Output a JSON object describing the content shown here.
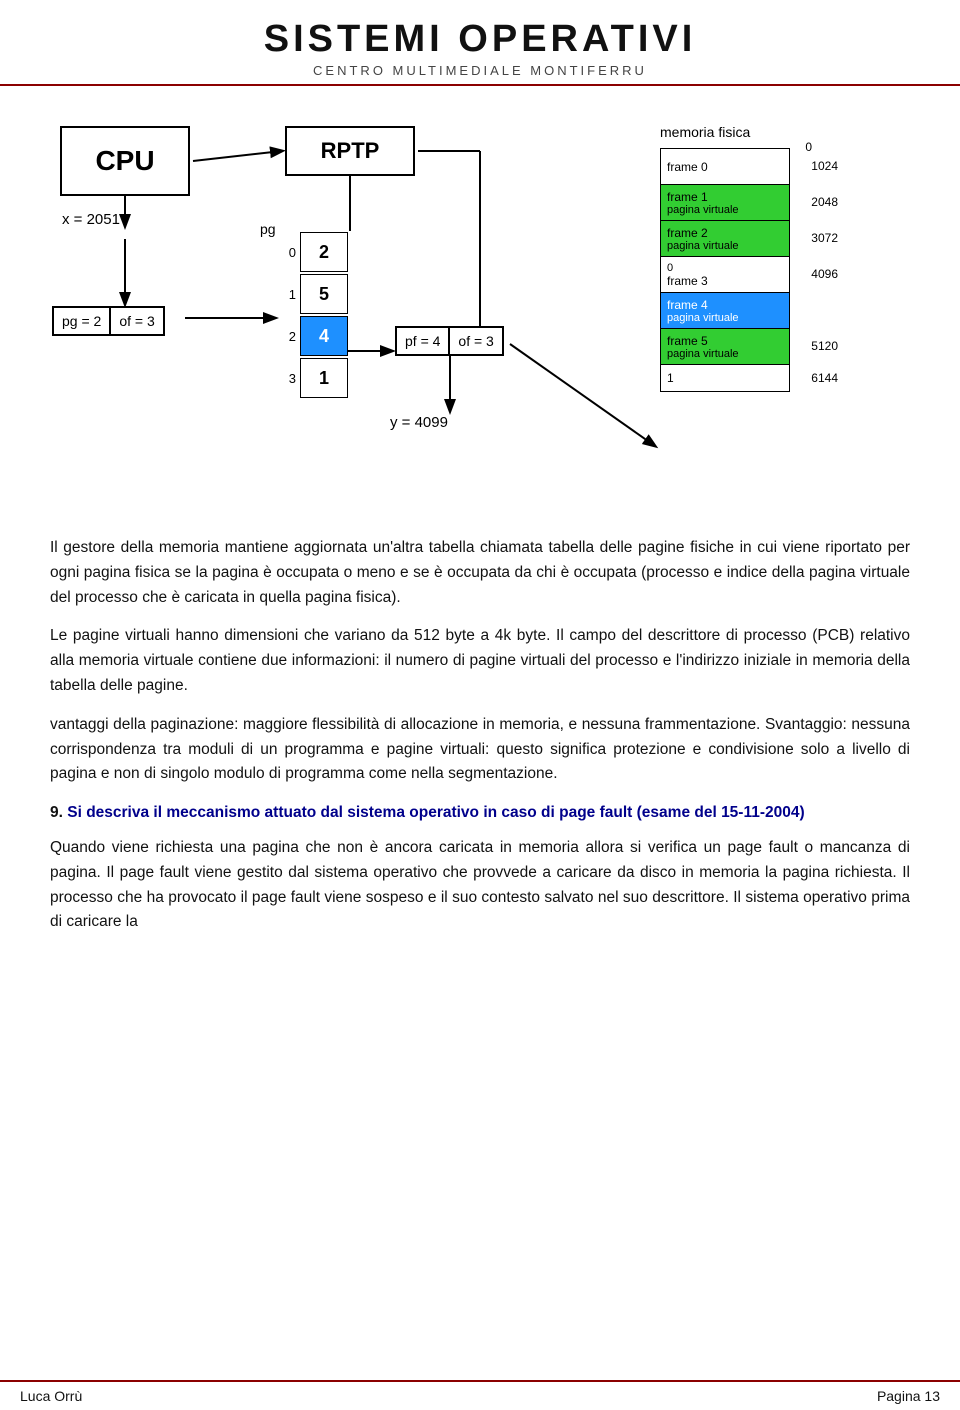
{
  "header": {
    "title": "SISTEMI OPERATIVI",
    "subtitle": "CENTRO MULTIMEDIALE MONTIFERRU"
  },
  "diagram": {
    "cpu_label": "CPU",
    "x_label": "x = 2051",
    "pg_label": "pg",
    "rptp_label": "RPTP",
    "pg_box_left": "pg = 2",
    "pg_box_right": "of = 3",
    "page_table": {
      "rows": [
        {
          "index": "0",
          "value": "2",
          "highlight": false
        },
        {
          "index": "1",
          "value": "5",
          "highlight": false
        },
        {
          "index": "2",
          "value": "4",
          "highlight": true
        },
        {
          "index": "3",
          "value": "1",
          "highlight": false
        }
      ]
    },
    "pf_box_left": "pf = 4",
    "pf_box_right": "of = 3",
    "y_label": "y = 4099",
    "mem_fisica_label": "memoria  fisica",
    "mem_label_0": "0",
    "memory": [
      {
        "label": "frame 0",
        "sublabel": "",
        "style": "normal",
        "right_label": "0"
      },
      {
        "label": "frame 1",
        "sublabel": "pagina virtuale",
        "style": "green",
        "right_label": "1024"
      },
      {
        "label": "frame 2",
        "sublabel": "pagina virtuale",
        "style": "green",
        "right_label": "2048"
      },
      {
        "label": "0",
        "sublabel": "frame 3",
        "style": "normal",
        "right_label": "3072"
      },
      {
        "label": "",
        "sublabel": "",
        "style": "normal",
        "right_label": "4096"
      },
      {
        "label": "frame 4",
        "sublabel": "pagina virtuale",
        "style": "blue",
        "right_label": ""
      },
      {
        "label": "frame 5",
        "sublabel": "pagina virtuale",
        "style": "green",
        "right_label": "5120"
      },
      {
        "label": "1",
        "sublabel": "",
        "style": "normal",
        "right_label": "6144"
      }
    ]
  },
  "content": {
    "para1": "Il gestore della memoria mantiene aggiornata un'altra tabella chiamata tabella delle pagine fisiche in cui viene riportato per ogni pagina fisica se la pagina è occupata o meno e se è occupata da chi è occupata (processo e indice della pagina virtuale del processo che è caricata in quella pagina fisica).",
    "para2": "Le pagine virtuali hanno dimensioni che variano da 512 byte a 4k byte. Il campo del descrittore di processo (PCB) relativo alla memoria virtuale contiene due informazioni: il numero di pagine virtuali del processo e l'indirizzo iniziale in memoria della tabella delle pagine.",
    "para3": "vantaggi della paginazione: maggiore flessibilità di allocazione in memoria, e nessuna frammentazione. Svantaggio: nessuna corrispondenza tra moduli di un programma e pagine virtuali: questo significa protezione e condivisione solo a livello di pagina e non di singolo modulo di programma come nella segmentazione.",
    "question_num": "9.",
    "question_title": "Si descriva il meccanismo attuato dal sistema operativo in caso di page fault (esame del 15-11-2004)",
    "answer": "Quando viene richiesta una pagina che non è ancora caricata in memoria allora si verifica un page fault o mancanza di pagina. Il page fault viene gestito dal sistema operativo che provvede a caricare da disco in memoria la pagina richiesta. Il processo che ha provocato il page fault viene sospeso e il suo contesto salvato nel suo descrittore. Il sistema operativo prima di caricare la"
  },
  "footer": {
    "left": "Luca Orrù",
    "right": "Pagina 13"
  }
}
